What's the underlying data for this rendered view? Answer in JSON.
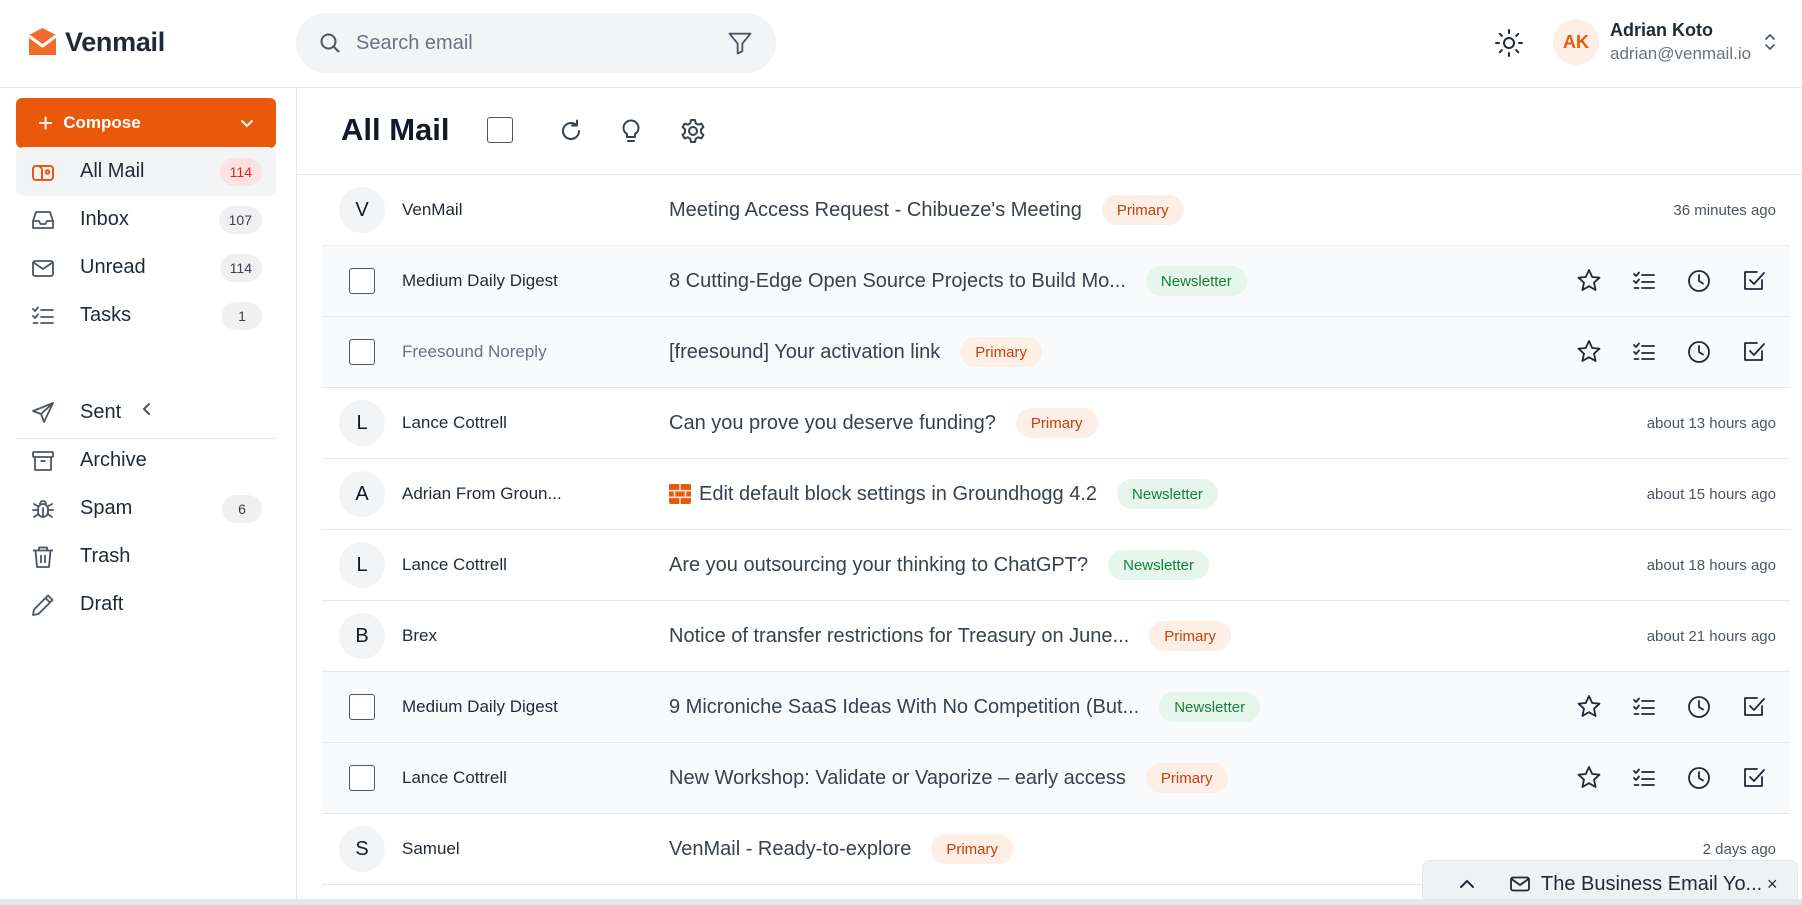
{
  "app": {
    "name": "Venmail",
    "brand_color": "#ea580c"
  },
  "search": {
    "placeholder": "Search email"
  },
  "user": {
    "initials": "AK",
    "name": "Adrian Koto",
    "email": "adrian@venmail.io"
  },
  "sidebar": {
    "compose_label": "Compose",
    "items": [
      {
        "label": "All Mail",
        "count": "114",
        "icon": "mailbox-icon",
        "active": true
      },
      {
        "label": "Inbox",
        "count": "107",
        "icon": "inbox-icon"
      },
      {
        "label": "Unread",
        "count": "114",
        "icon": "mail-icon"
      },
      {
        "label": "Tasks",
        "count": "1",
        "icon": "list-check-icon"
      },
      {
        "label": "Sent",
        "count": "",
        "icon": "send-icon"
      },
      {
        "label": "Archive",
        "count": "",
        "icon": "archive-icon"
      },
      {
        "label": "Spam",
        "count": "6",
        "icon": "bug-icon"
      },
      {
        "label": "Trash",
        "count": "",
        "icon": "trash-icon"
      },
      {
        "label": "Draft",
        "count": "",
        "icon": "pencil-icon"
      }
    ]
  },
  "main": {
    "title": "All Mail",
    "emails": [
      {
        "lead": "letter",
        "letter": "V",
        "sender": "VenMail",
        "subject": "Meeting Access Request - Chibueze's Meeting",
        "tag": "Primary",
        "time": "36 minutes ago",
        "muted": false
      },
      {
        "lead": "checkbox",
        "sender": "Medium Daily Digest",
        "subject": "8 Cutting-Edge Open Source Projects to Build Mo...",
        "tag": "Newsletter",
        "time": "",
        "muted": false
      },
      {
        "lead": "checkbox",
        "sender": "Freesound Noreply",
        "subject": "[freesound] Your activation link",
        "tag": "Primary",
        "time": "",
        "muted": true
      },
      {
        "lead": "letter",
        "letter": "L",
        "sender": "Lance Cottrell",
        "subject": "Can you prove you deserve funding?",
        "tag": "Primary",
        "time": "about 13 hours ago",
        "muted": false
      },
      {
        "lead": "letter",
        "letter": "A",
        "sender": "Adrian From Groun...",
        "subject": "Edit default block settings in Groundhogg 4.2",
        "tag": "Newsletter",
        "time": "about 15 hours ago",
        "muted": false,
        "emoji": "brick"
      },
      {
        "lead": "letter",
        "letter": "L",
        "sender": "Lance Cottrell",
        "subject": "Are you outsourcing your thinking to ChatGPT?",
        "tag": "Newsletter",
        "time": "about 18 hours ago",
        "muted": false
      },
      {
        "lead": "letter",
        "letter": "B",
        "sender": "Brex",
        "subject": "Notice of transfer restrictions for Treasury on June...",
        "tag": "Primary",
        "time": "about 21 hours ago",
        "muted": false
      },
      {
        "lead": "checkbox",
        "sender": "Medium Daily Digest",
        "subject": "9 Microniche SaaS Ideas With No Competition (But...",
        "tag": "Newsletter",
        "time": "",
        "muted": false
      },
      {
        "lead": "checkbox",
        "sender": "Lance Cottrell",
        "subject": "New Workshop: Validate or Vaporize – early access",
        "tag": "Primary",
        "time": "",
        "muted": false
      },
      {
        "lead": "letter",
        "letter": "S",
        "sender": "Samuel",
        "subject": "VenMail - Ready-to-explore",
        "tag": "Primary",
        "time": "2 days ago",
        "muted": false
      }
    ]
  },
  "toast": {
    "text": "The Business Email Yo...",
    "close": "×"
  }
}
